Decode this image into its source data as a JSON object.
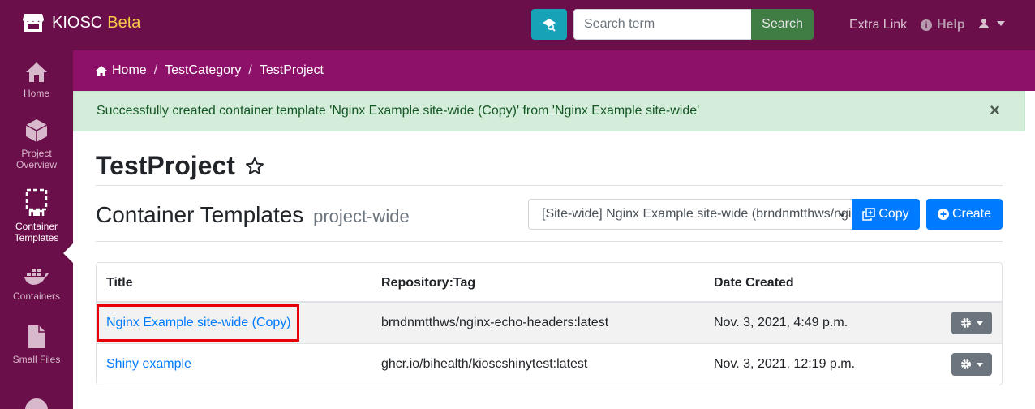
{
  "app": {
    "name": "KIOSC",
    "badge": "Beta"
  },
  "navbar": {
    "search_placeholder": "Search term",
    "search_button": "Search",
    "extra_link": "Extra Link",
    "help": "Help",
    "icons": [
      "store-icon",
      "advanced-search-icon",
      "info-icon",
      "user-icon",
      "caret-down-icon"
    ]
  },
  "sidebar": {
    "items": [
      {
        "label": "Home",
        "icon": "home-icon",
        "active": false
      },
      {
        "label": "Project Overview",
        "icon": "cube-icon",
        "active": false
      },
      {
        "label": "Container Templates",
        "icon": "template-icon",
        "active": true
      },
      {
        "label": "Containers",
        "icon": "docker-icon",
        "active": false
      },
      {
        "label": "Small Files",
        "icon": "file-icon",
        "active": false
      }
    ]
  },
  "breadcrumb": {
    "items": [
      "Home",
      "TestCategory",
      "TestProject"
    ],
    "separator": "/"
  },
  "alert": {
    "message": "Successfully created container template 'Nginx Example site-wide (Copy)' from 'Nginx Example site-wide'",
    "close": "×"
  },
  "project": {
    "title": "TestProject"
  },
  "section": {
    "title": "Container Templates",
    "subtitle": "project-wide",
    "select_value": "[Site-wide] Nginx Example site-wide (brndnmtthws/nginx-echo-headers:latest)",
    "copy_button": "Copy",
    "create_button": "Create"
  },
  "table": {
    "columns": [
      "Title",
      "Repository:Tag",
      "Date Created"
    ],
    "rows": [
      {
        "title": "Nginx Example site-wide (Copy)",
        "repo": "brndnmtthws/nginx-echo-headers:latest",
        "date": "Nov. 3, 2021, 4:49 p.m."
      },
      {
        "title": "Shiny example",
        "repo": "ghcr.io/bihealth/kioscshinytest:latest",
        "date": "Nov. 3, 2021, 12:19 p.m."
      }
    ]
  },
  "colors": {
    "navbar_bg": "#6b0f4a",
    "breadcrumb_bg": "#8e1169",
    "alert_bg": "#d4edda",
    "primary": "#007bff",
    "highlight": "#e8000b"
  }
}
